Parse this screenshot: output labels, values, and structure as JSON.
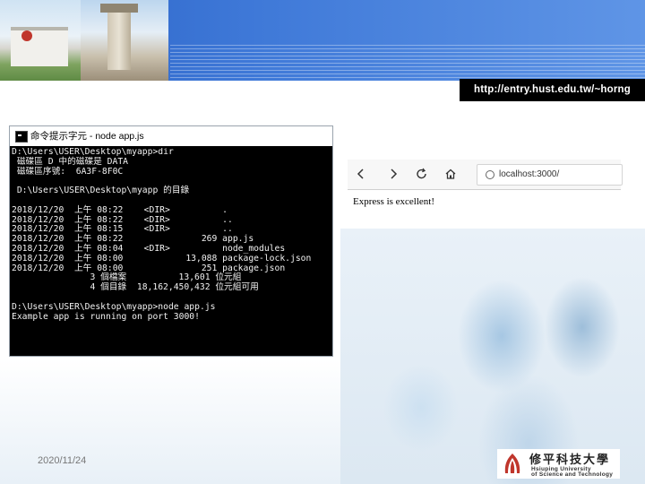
{
  "header": {
    "url_banner": "http://entry.hust.edu.tw/~horng"
  },
  "cmd_window": {
    "title": "命令提示字元 - node  app.js",
    "lines": [
      "D:\\Users\\USER\\Desktop\\myapp>dir",
      " 磁碟區 D 中的磁碟是 DATA",
      " 磁碟區序號:  6A3F-8F0C",
      "",
      " D:\\Users\\USER\\Desktop\\myapp 的目錄",
      "",
      "2018/12/20  上午 08:22    <DIR>          .",
      "2018/12/20  上午 08:22    <DIR>          ..",
      "2018/12/20  上午 08:15    <DIR>          ..",
      "2018/12/20  上午 08:22               269 app.js",
      "2018/12/20  上午 08:04    <DIR>          node_modules",
      "2018/12/20  上午 08:00            13,088 package-lock.json",
      "2018/12/20  上午 08:00               251 package.json",
      "               3 個檔案          13,601 位元組",
      "               4 個目錄  18,162,450,432 位元組可用",
      "",
      "D:\\Users\\USER\\Desktop\\myapp>node app.js",
      "Example app is running on port 3000!"
    ]
  },
  "browser": {
    "url": "localhost:3000/",
    "page_text": "Express is excellent!"
  },
  "footer": {
    "date": "2020/11/24",
    "logo_cn": "修平科技大學",
    "logo_en_line1": "Hsiuping University",
    "logo_en_line2": "of Science and Technology"
  }
}
